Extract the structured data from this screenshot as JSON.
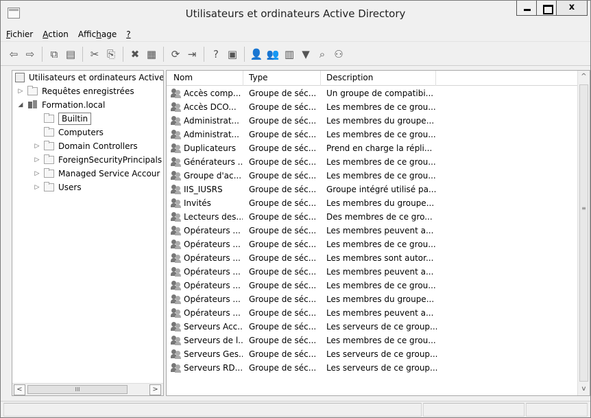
{
  "window": {
    "title": "Utilisateurs et ordinateurs Active Directory",
    "caption_buttons": {
      "minimize": "–",
      "maximize": "□",
      "close": "x"
    }
  },
  "menu": {
    "items": [
      {
        "label": "Fichier",
        "accesskey": "F"
      },
      {
        "label": "Action",
        "accesskey": "A"
      },
      {
        "label": "Affichage",
        "accesskey": "h"
      },
      {
        "label": "?",
        "accesskey": "?"
      }
    ]
  },
  "toolbar": {
    "buttons": [
      {
        "name": "back-icon",
        "glyph": "⇦"
      },
      {
        "name": "forward-icon",
        "glyph": "⇨"
      },
      {
        "name": "sep"
      },
      {
        "name": "up-folder-icon",
        "glyph": "⧉"
      },
      {
        "name": "show-console-tree-icon",
        "glyph": "▤"
      },
      {
        "name": "sep"
      },
      {
        "name": "cut-icon",
        "glyph": "✂"
      },
      {
        "name": "copy-icon",
        "glyph": "⎘"
      },
      {
        "name": "sep"
      },
      {
        "name": "delete-icon",
        "glyph": "✖"
      },
      {
        "name": "properties-icon",
        "glyph": "▦"
      },
      {
        "name": "sep"
      },
      {
        "name": "refresh-icon",
        "glyph": "⟳"
      },
      {
        "name": "export-list-icon",
        "glyph": "⇥"
      },
      {
        "name": "sep"
      },
      {
        "name": "help-icon",
        "glyph": "?"
      },
      {
        "name": "action-pane-icon",
        "glyph": "▣"
      },
      {
        "name": "sep"
      },
      {
        "name": "new-user-icon",
        "glyph": "👤"
      },
      {
        "name": "new-group-icon",
        "glyph": "👥"
      },
      {
        "name": "new-ou-icon",
        "glyph": "▥"
      },
      {
        "name": "filter-icon",
        "glyph": "▼"
      },
      {
        "name": "find-icon",
        "glyph": "⌕"
      },
      {
        "name": "add-to-group-icon",
        "glyph": "⚇"
      }
    ]
  },
  "tree": {
    "root": "Utilisateurs et ordinateurs Active",
    "saved_queries": "Requêtes enregistrées",
    "domain": "Formation.local",
    "children": [
      "Builtin",
      "Computers",
      "Domain Controllers",
      "ForeignSecurityPrincipals",
      "Managed Service Accour",
      "Users"
    ],
    "hscroll_thumb": "III"
  },
  "list": {
    "columns": {
      "name": "Nom",
      "type": "Type",
      "description": "Description"
    },
    "rows": [
      {
        "name": "Accès comp...",
        "type": "Groupe de séc...",
        "description": "Un groupe de compatibi..."
      },
      {
        "name": "Accès DCO...",
        "type": "Groupe de séc...",
        "description": "Les membres de ce grou..."
      },
      {
        "name": "Administrat...",
        "type": "Groupe de séc...",
        "description": "Les membres du groupe..."
      },
      {
        "name": "Administrat...",
        "type": "Groupe de séc...",
        "description": "Les membres de ce grou..."
      },
      {
        "name": "Duplicateurs",
        "type": "Groupe de séc...",
        "description": "Prend en charge la répli..."
      },
      {
        "name": "Générateurs ...",
        "type": "Groupe de séc...",
        "description": "Les membres de ce grou..."
      },
      {
        "name": "Groupe d'ac...",
        "type": "Groupe de séc...",
        "description": "Les membres de ce grou..."
      },
      {
        "name": "IIS_IUSRS",
        "type": "Groupe de séc...",
        "description": "Groupe intégré utilisé pa..."
      },
      {
        "name": "Invités",
        "type": "Groupe de séc...",
        "description": "Les membres du groupe..."
      },
      {
        "name": "Lecteurs des...",
        "type": "Groupe de séc...",
        "description": "Des membres de ce gro..."
      },
      {
        "name": "Opérateurs ...",
        "type": "Groupe de séc...",
        "description": "Les membres peuvent a..."
      },
      {
        "name": "Opérateurs ...",
        "type": "Groupe de séc...",
        "description": "Les membres de ce grou..."
      },
      {
        "name": "Opérateurs ...",
        "type": "Groupe de séc...",
        "description": "Les membres sont autor..."
      },
      {
        "name": "Opérateurs ...",
        "type": "Groupe de séc...",
        "description": "Les membres peuvent a..."
      },
      {
        "name": "Opérateurs ...",
        "type": "Groupe de séc...",
        "description": "Les membres de ce grou..."
      },
      {
        "name": "Opérateurs ...",
        "type": "Groupe de séc...",
        "description": "Les membres du groupe..."
      },
      {
        "name": "Opérateurs ...",
        "type": "Groupe de séc...",
        "description": "Les membres peuvent a..."
      },
      {
        "name": "Serveurs Acc...",
        "type": "Groupe de séc...",
        "description": "Les serveurs de ce group..."
      },
      {
        "name": "Serveurs de l...",
        "type": "Groupe de séc...",
        "description": "Les membres de ce grou..."
      },
      {
        "name": "Serveurs Ges...",
        "type": "Groupe de séc...",
        "description": "Les serveurs de ce group..."
      },
      {
        "name": "Serveurs RD...",
        "type": "Groupe de séc...",
        "description": "Les serveurs de ce group..."
      }
    ],
    "vscroll_thumb": "≡"
  }
}
